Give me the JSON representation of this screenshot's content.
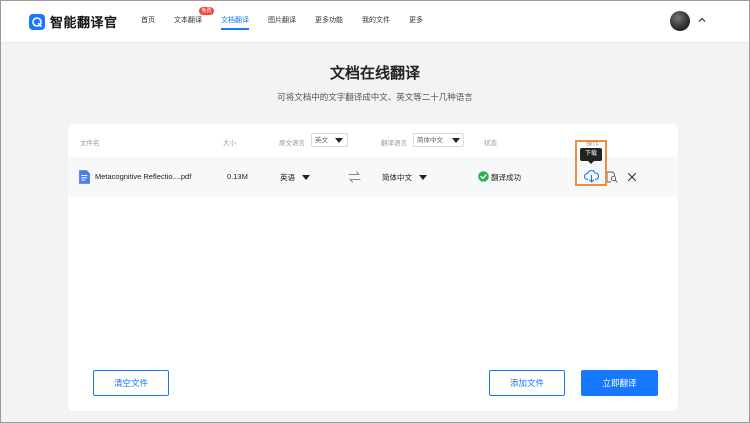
{
  "app": {
    "name": "智能翻译官"
  },
  "nav": {
    "items": [
      {
        "label": "首页"
      },
      {
        "label": "文本翻译",
        "badge": "免费"
      },
      {
        "label": "文档翻译",
        "active": true
      },
      {
        "label": "图片翻译"
      },
      {
        "label": "更多功能"
      },
      {
        "label": "我的文件"
      },
      {
        "label": "更多"
      }
    ]
  },
  "page": {
    "title": "文档在线翻译",
    "subtitle": "可将文档中的文字翻译成中文、英文等二十几种语言"
  },
  "table": {
    "headers": {
      "file_name": "文件名",
      "size": "大小",
      "source_lang": "原文语言",
      "target_lang": "翻译语言",
      "status": "状态",
      "action": "操作"
    },
    "source_lang_select": "英文",
    "target_lang_select": "简体中文",
    "rows": [
      {
        "file_name": "Metacognitive Reflectio....pdf",
        "size": "0.13M",
        "source_lang": "英语",
        "target_lang": "简体中文",
        "status": "翻译成功"
      }
    ]
  },
  "tooltip": {
    "download": "下载"
  },
  "buttons": {
    "clear": "清空文件",
    "add": "添加文件",
    "translate": "立即翻译"
  },
  "colors": {
    "accent": "#1677ff",
    "success": "#2fb24c",
    "highlight": "#f08c3c",
    "badge": "#f24b3c"
  },
  "icons": [
    "logo-icon",
    "avatar",
    "chevron-up-icon",
    "pdf-file-icon",
    "swap-icon",
    "success-check-icon",
    "download-icon",
    "preview-icon",
    "close-icon"
  ]
}
